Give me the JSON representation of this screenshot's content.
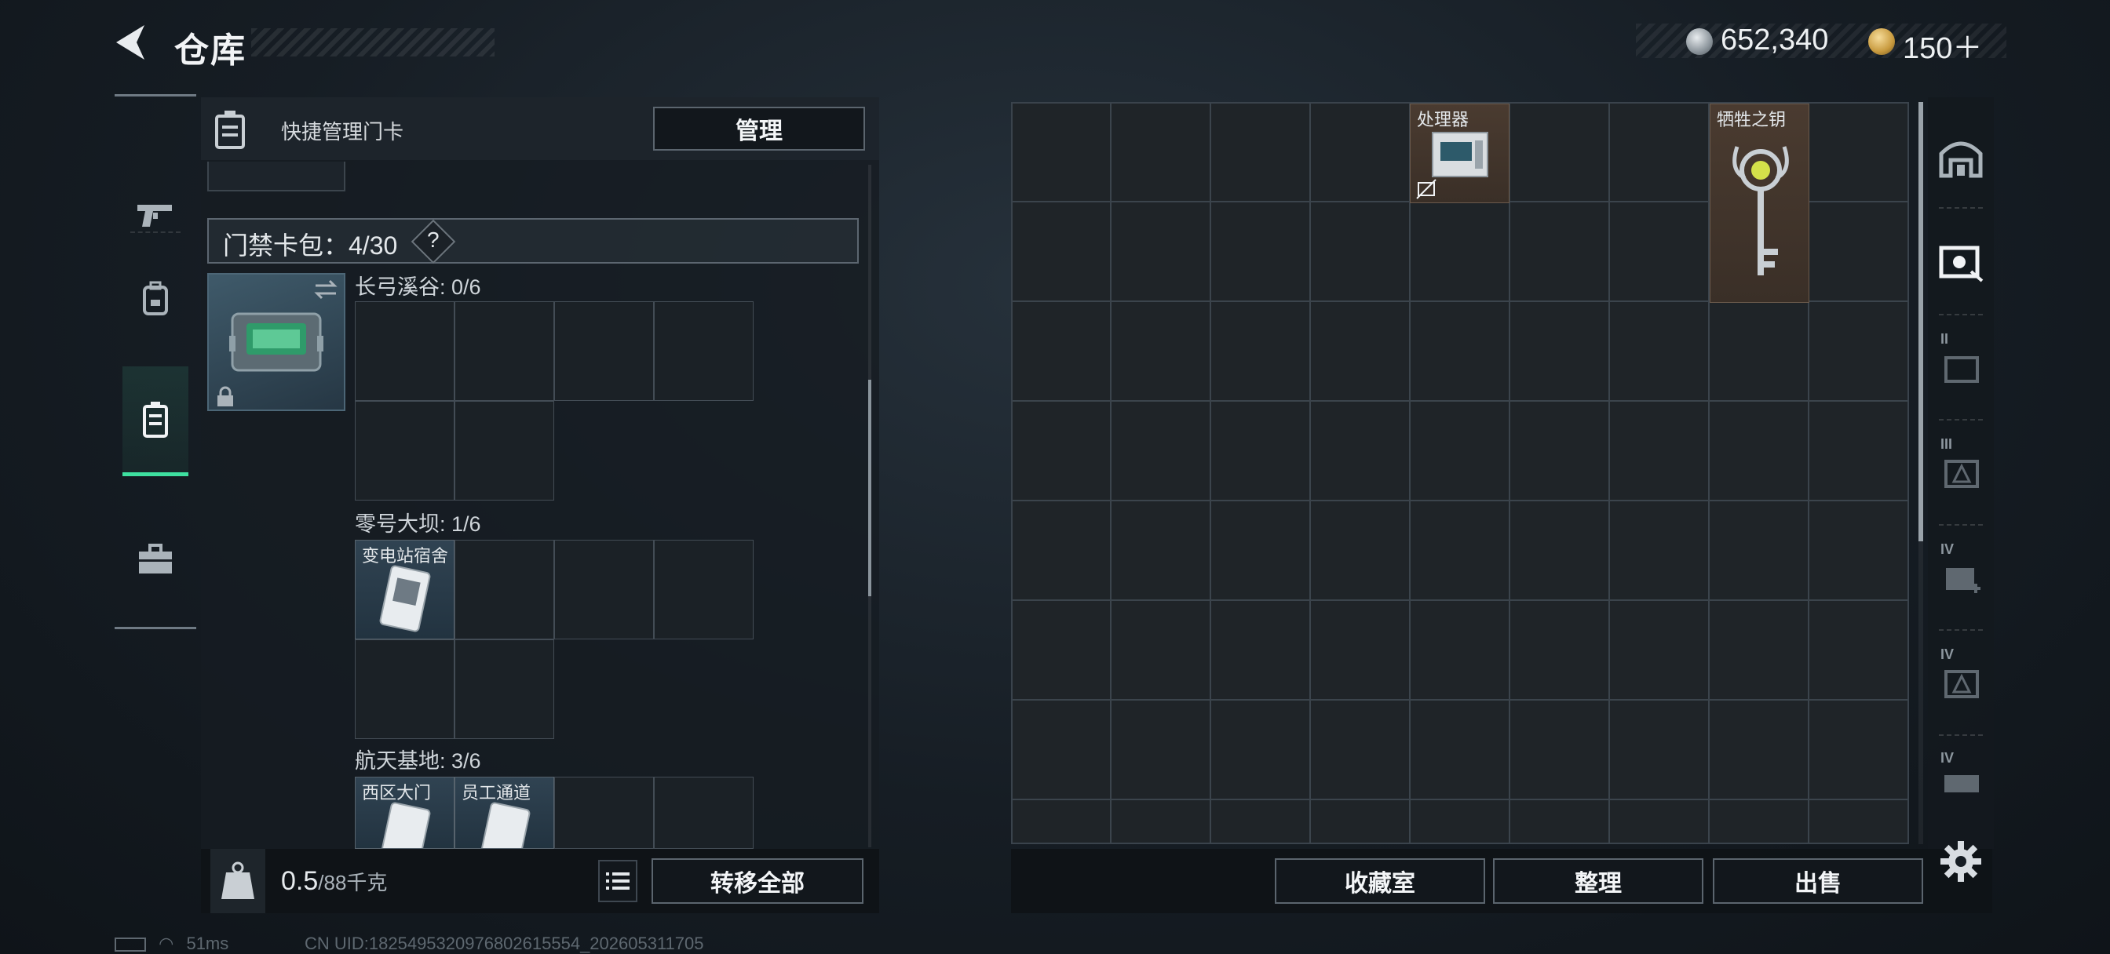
{
  "header": {
    "title": "仓库",
    "currency_silver": "652,340",
    "currency_gold": "150＋"
  },
  "card_panel": {
    "header_text": "快捷管理门卡",
    "manage_label": "管理",
    "capacity_label": "门禁卡包：4/30",
    "help_label": "?",
    "sections": [
      {
        "title": "长弓溪谷: 0/6",
        "items": []
      },
      {
        "title": "零号大坝: 1/6",
        "items": [
          {
            "label": "变电站宿舍"
          }
        ]
      },
      {
        "title": "航天基地: 3/6",
        "items": [
          {
            "label": "西区大门"
          },
          {
            "label": "员工通道"
          }
        ]
      }
    ],
    "weight_value": "0.5",
    "weight_max": "/88千克",
    "transfer_all_label": "转移全部"
  },
  "storage": {
    "items": [
      {
        "label": "处理器"
      },
      {
        "label": "牺牲之钥"
      }
    ],
    "collection_label": "收藏室",
    "sort_label": "整理",
    "sell_label": "出售"
  },
  "right_tabs": [
    "II",
    "III",
    "IV",
    "IV",
    "IV"
  ],
  "status": {
    "ping": "51ms",
    "uid": "CN UID:1825495320976802615554_202605311705"
  },
  "colors": {
    "accent": "#3ee0a0",
    "item_bg_brown": "#4a3b30",
    "item_bg_blue": "#304352"
  }
}
